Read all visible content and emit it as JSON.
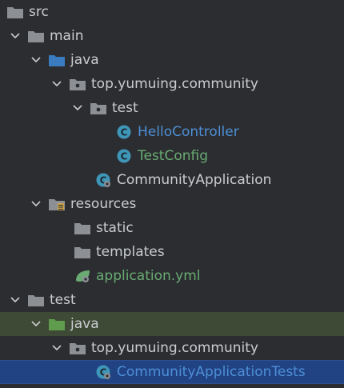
{
  "tree": {
    "src": "src",
    "main": "main",
    "java": "java",
    "pkg_main": "top.yumuing.community",
    "test_pkg": "test",
    "hello": "HelloController",
    "testconfig": "TestConfig",
    "app": "CommunityApplication",
    "resources": "resources",
    "static": "static",
    "templates": "templates",
    "yml": "application.yml",
    "test": "test",
    "java2": "java",
    "pkg_test": "top.yumuing.community",
    "tests": "CommunityApplicationTests"
  },
  "colors": {
    "background": "#2b2d30",
    "text": "#c9ccd1",
    "folder": "#8c9095",
    "java_folder": "#3b7bbf",
    "test_java_folder": "#5f9c4d",
    "class_icon": "#3e97b8",
    "modified_green": "#6aab73",
    "modified_blue": "#4d8fd6",
    "selected_row": "#214283",
    "test_root_row": "#3f4a36"
  }
}
